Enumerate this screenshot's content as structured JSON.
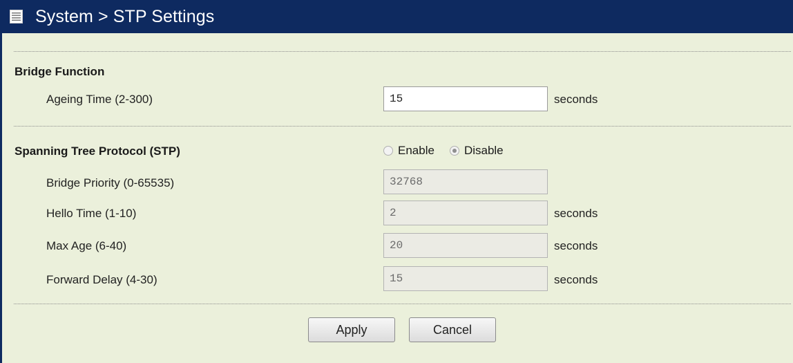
{
  "header": {
    "icon": "list-icon",
    "title": "System > STP Settings"
  },
  "bridge_function": {
    "title": "Bridge Function",
    "ageing_time": {
      "label": "Ageing Time (2-300)",
      "value": "15",
      "unit": "seconds"
    }
  },
  "stp": {
    "title": "Spanning Tree Protocol (STP)",
    "radio_options": [
      {
        "label": "Enable",
        "checked": false
      },
      {
        "label": "Disable",
        "checked": true
      }
    ],
    "fields": [
      {
        "label": "Bridge Priority (0-65535)",
        "value": "32768",
        "unit": ""
      },
      {
        "label": "Hello Time (1-10)",
        "value": "2",
        "unit": "seconds"
      },
      {
        "label": "Max Age (6-40)",
        "value": "20",
        "unit": "seconds"
      },
      {
        "label": "Forward Delay (4-30)",
        "value": "15",
        "unit": "seconds"
      }
    ]
  },
  "buttons": {
    "apply": "Apply",
    "cancel": "Cancel"
  },
  "colors": {
    "header_bg": "#0e2a60",
    "content_bg": "#ebf0db",
    "disabled_field_bg": "#ebebe4"
  }
}
